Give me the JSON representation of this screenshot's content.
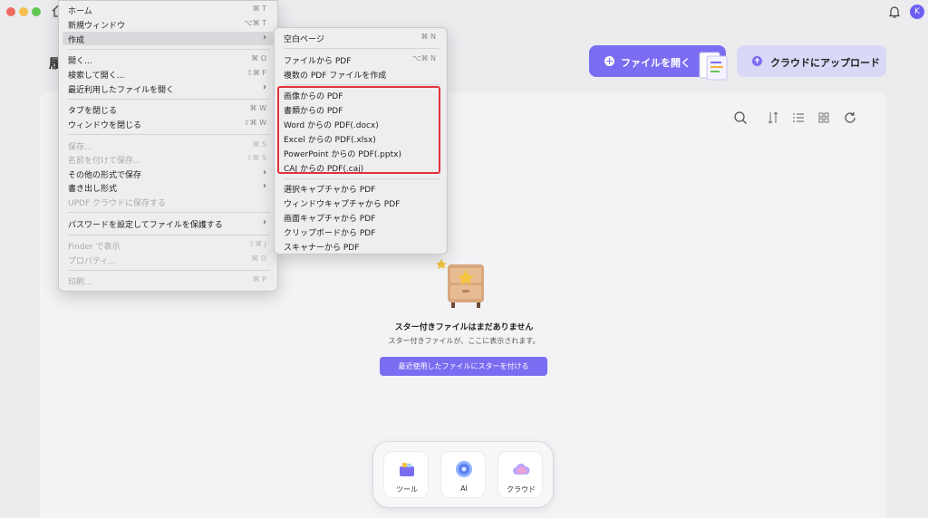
{
  "window": {
    "avatar_initial": "K"
  },
  "page": {
    "heading": "履"
  },
  "header": {
    "open_button": "ファイルを開く",
    "upload_button": "クラウドにアップロード"
  },
  "empty_state": {
    "title": "スター付きファイルはまだありません",
    "subtitle": "スター付きファイルが、ここに表示されます。",
    "button": "最近使用したファイルにスターを付ける"
  },
  "dock": {
    "items": [
      {
        "label": "ツール",
        "icon": "toolbox-icon"
      },
      {
        "label": "AI",
        "icon": "ai-icon"
      },
      {
        "label": "クラウド",
        "icon": "cloud-icon"
      }
    ]
  },
  "file_menu": {
    "items": [
      {
        "label": "ホーム",
        "shortcut": "⌘ T"
      },
      {
        "label": "新規ウィンドウ",
        "shortcut": "⌥⌘ T"
      },
      {
        "label": "作成",
        "submenu": true
      },
      {
        "label": "開く...",
        "shortcut": "⌘ O"
      },
      {
        "label": "検索して開く...",
        "shortcut": "⇧⌘ F"
      },
      {
        "label": "最近利用したファイルを開く",
        "submenu": true
      },
      {
        "label": "タブを閉じる",
        "shortcut": "⌘ W"
      },
      {
        "label": "ウィンドウを閉じる",
        "shortcut": "⇧⌘ W"
      },
      {
        "label": "保存...",
        "shortcut": "⌘ S",
        "disabled": true
      },
      {
        "label": "名前を付けて保存...",
        "shortcut": "⇧⌘ S",
        "disabled": true
      },
      {
        "label": "その他の形式で保存",
        "submenu": true
      },
      {
        "label": "書き出し形式",
        "submenu": true
      },
      {
        "label": "UPDF クラウドに保存する",
        "disabled": true
      },
      {
        "label": "パスワードを設定してファイルを保護する",
        "submenu": true
      },
      {
        "label": "Finder で表示",
        "shortcut": "⇧⌘ J",
        "disabled": true
      },
      {
        "label": "プロパティ...",
        "shortcut": "⌘ D",
        "disabled": true
      },
      {
        "label": "印刷...",
        "shortcut": "⌘ P",
        "disabled": true
      }
    ]
  },
  "create_submenu": {
    "items": [
      {
        "label": "空白ページ",
        "shortcut": "⌘ N"
      },
      {
        "label": "ファイルから PDF",
        "shortcut": "⌥⌘ N"
      },
      {
        "label": "複数の PDF ファイルを作成"
      },
      {
        "label": "画像からの PDF"
      },
      {
        "label": "書類からの PDF"
      },
      {
        "label": "Word からの PDF(.docx)"
      },
      {
        "label": "Excel からの PDF(.xlsx)"
      },
      {
        "label": "PowerPoint からの PDF(.pptx)"
      },
      {
        "label": "CAJ からの PDF(.caj)"
      },
      {
        "label": "選択キャプチャから PDF"
      },
      {
        "label": "ウィンドウキャプチャから PDF"
      },
      {
        "label": "画面キャプチャから PDF"
      },
      {
        "label": "クリップボードから PDF"
      },
      {
        "label": "スキャナーから PDF"
      }
    ]
  },
  "colors": {
    "accent": "#7b6df2",
    "highlight_border": "#e0323c"
  }
}
